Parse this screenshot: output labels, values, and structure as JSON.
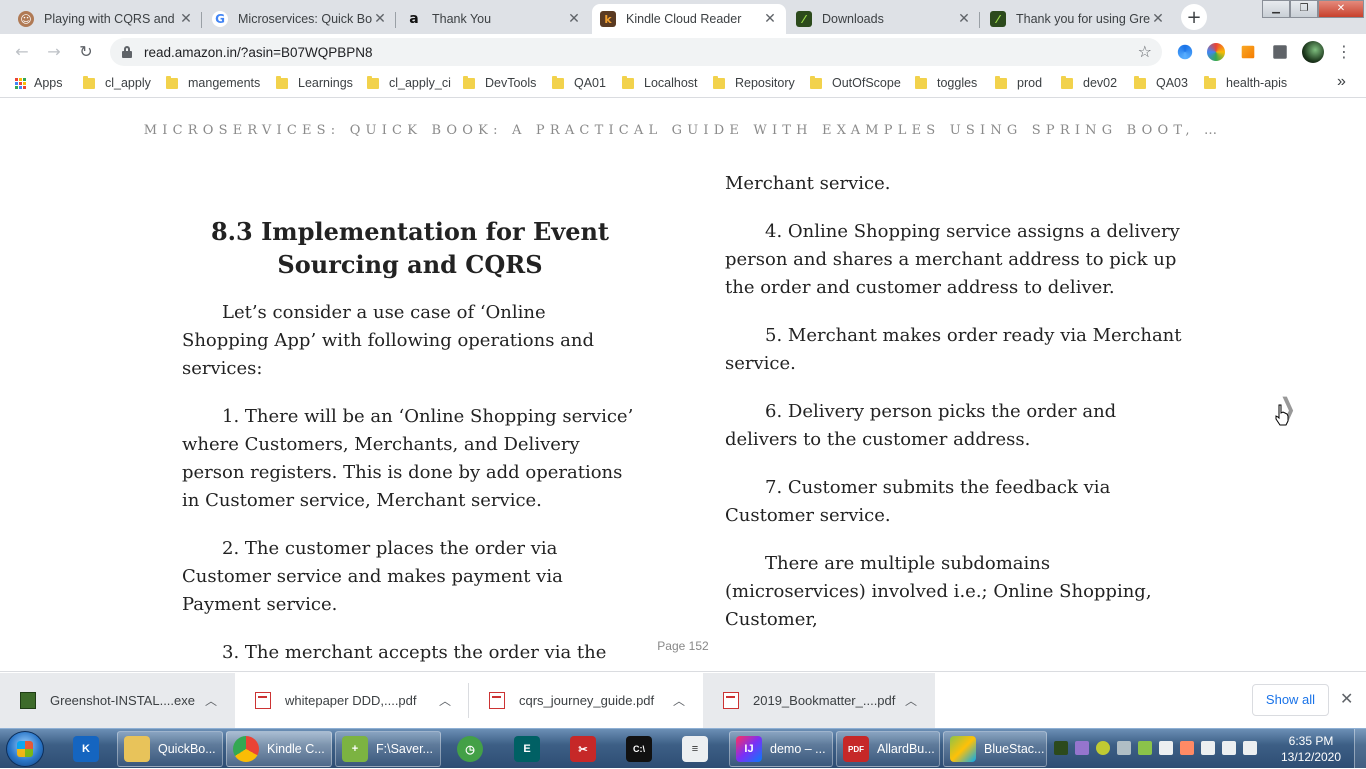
{
  "browser": {
    "tabs": [
      {
        "title": "Playing with CQRS and E",
        "icon": "avatar-icon",
        "active": false
      },
      {
        "title": "Microservices: Quick Boo",
        "icon": "google-icon",
        "active": false
      },
      {
        "title": "Thank You",
        "icon": "amazon-icon",
        "active": false
      },
      {
        "title": "Kindle Cloud Reader",
        "icon": "kindle-icon",
        "active": true
      },
      {
        "title": "Downloads",
        "icon": "greenshot-icon",
        "active": false
      },
      {
        "title": "Thank you for using Gre",
        "icon": "greenshot-icon",
        "active": false
      }
    ],
    "url": "read.amazon.in/?asin=B07WQPBPN8",
    "bookmarks": [
      {
        "label": "Apps",
        "type": "apps"
      },
      {
        "label": "cl_apply",
        "type": "folder"
      },
      {
        "label": "mangements",
        "type": "folder"
      },
      {
        "label": "Learnings",
        "type": "folder"
      },
      {
        "label": "cl_apply_ci",
        "type": "folder"
      },
      {
        "label": "DevTools",
        "type": "folder"
      },
      {
        "label": "QA01",
        "type": "folder"
      },
      {
        "label": "Localhost",
        "type": "folder"
      },
      {
        "label": "Repository",
        "type": "folder"
      },
      {
        "label": "OutOfScope",
        "type": "folder"
      },
      {
        "label": "toggles",
        "type": "folder"
      },
      {
        "label": "prod",
        "type": "folder"
      },
      {
        "label": "dev02",
        "type": "folder"
      },
      {
        "label": "QA03",
        "type": "folder"
      },
      {
        "label": "health-apis",
        "type": "folder"
      }
    ],
    "bookmarks_overflow": "»"
  },
  "reader": {
    "book_title": "MICROSERVICES: QUICK BOOK: A PRACTICAL GUIDE WITH EXAMPLES USING SPRING BOOT, …",
    "left_column": {
      "heading": "8.3 Implementation for Event Sourcing and CQRS",
      "paragraphs": [
        "Let’s consider a use case of ‘Online Shopping App’ with following operations and services:",
        "1. There will be an ‘Online Shopping service’ where Customers, Merchants, and Delivery person registers. This is done by add operations in Customer service, Merchant service.",
        "2. The customer places the order via Customer service and makes payment via Payment service.",
        "3. The merchant accepts the order via the"
      ]
    },
    "right_column": {
      "paragraphs": [
        "Merchant service.",
        "4. Online Shopping service assigns a delivery person and shares a merchant address to pick up the order and customer address to deliver.",
        "5. Merchant makes order ready via Merchant service.",
        "6. Delivery person picks the order and delivers to the customer address.",
        "7. Customer submits the feedback via Customer service.",
        "There are multiple subdomains (microservices) involved i.e.; Online Shopping, Customer,"
      ]
    },
    "page_label": "Page 152",
    "next_page_icon": "chevron-right-icon"
  },
  "downloads": {
    "items": [
      {
        "name": "Greenshot-INSTAL....exe",
        "type": "exe"
      },
      {
        "name": "whitepaper DDD,....pdf",
        "type": "pdf"
      },
      {
        "name": "cqrs_journey_guide.pdf",
        "type": "pdf"
      },
      {
        "name": "2019_Bookmatter_....pdf",
        "type": "pdf"
      }
    ],
    "show_all_label": "Show all"
  },
  "taskbar": {
    "items": [
      {
        "label": "",
        "icon": "kindle-app-icon",
        "pinned": true
      },
      {
        "label": "QuickBo...",
        "icon": "folder-icon",
        "pinned": false
      },
      {
        "label": "Kindle C...",
        "icon": "chrome-icon",
        "pinned": false
      },
      {
        "label": "F:\\Saver...",
        "icon": "notepad-plus-icon",
        "pinned": false
      },
      {
        "label": "",
        "icon": "clock-app-icon",
        "pinned": true
      },
      {
        "label": "",
        "icon": "editor-app-icon",
        "pinned": true
      },
      {
        "label": "",
        "icon": "snipping-tool-icon",
        "pinned": true
      },
      {
        "label": "",
        "icon": "cmd-icon",
        "pinned": true
      },
      {
        "label": "",
        "icon": "calculator-app-icon",
        "pinned": true
      },
      {
        "label": "demo – ...",
        "icon": "intellij-icon",
        "pinned": false
      },
      {
        "label": "AllardBu...",
        "icon": "pdf-reader-icon",
        "pinned": false
      },
      {
        "label": "BlueStac...",
        "icon": "bluestacks-icon",
        "pinned": false
      }
    ],
    "time": "6:35 PM",
    "date": "13/12/2020"
  },
  "colors": {
    "tabstrip": "#dee1e6",
    "accent_link": "#1a73e8",
    "folder": "#f2d24c",
    "taskbar": "#3d5f86"
  }
}
